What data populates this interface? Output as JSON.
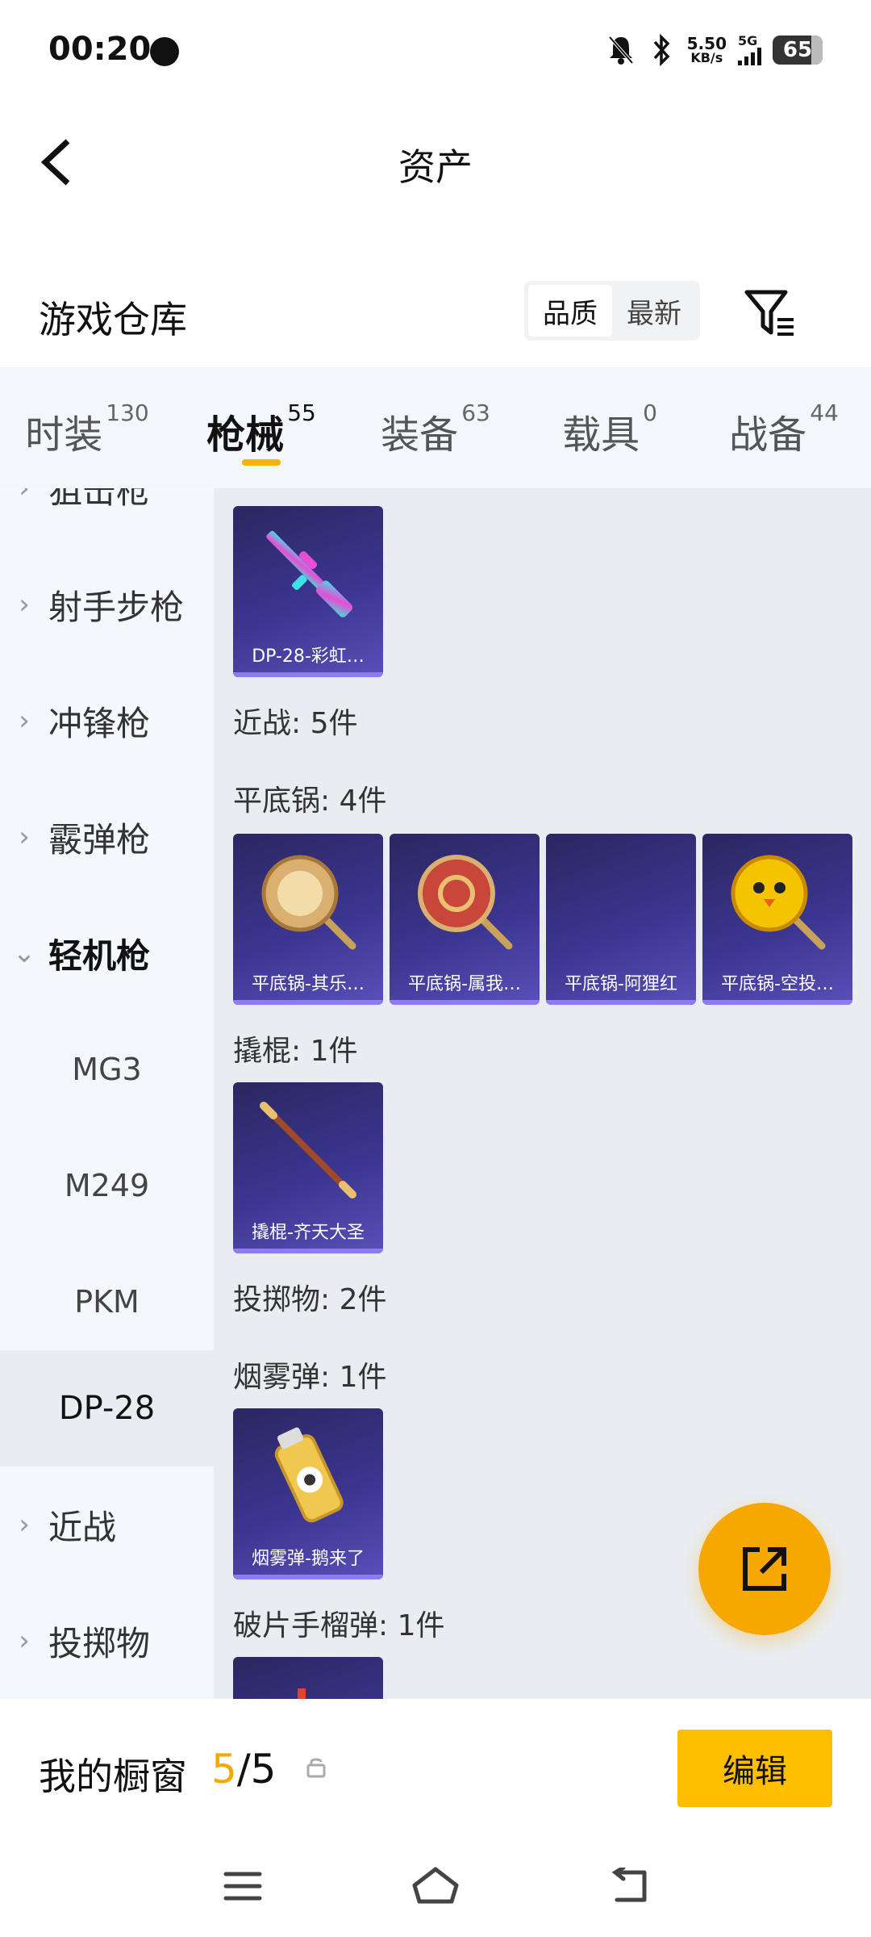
{
  "status_bar": {
    "time": "00:20",
    "speed_value": "5.50",
    "speed_unit": "KB/s",
    "network": "5G",
    "battery": "65"
  },
  "header": {
    "title": "资产"
  },
  "warehouse": {
    "title": "游戏仓库",
    "sort_options": [
      "品质",
      "最新"
    ],
    "sort_selected": "品质"
  },
  "tabs": [
    {
      "label": "时装",
      "count": "130"
    },
    {
      "label": "枪械",
      "count": "55",
      "active": true
    },
    {
      "label": "装备",
      "count": "63"
    },
    {
      "label": "载具",
      "count": "0"
    },
    {
      "label": "战备",
      "count": "44"
    }
  ],
  "sidebar": {
    "items": [
      {
        "label": "狙击枪",
        "type": "category"
      },
      {
        "label": "射手步枪",
        "type": "category"
      },
      {
        "label": "冲锋枪",
        "type": "category"
      },
      {
        "label": "霰弹枪",
        "type": "category"
      },
      {
        "label": "轻机枪",
        "type": "category-open"
      },
      {
        "label": "MG3",
        "type": "sub"
      },
      {
        "label": "M249",
        "type": "sub"
      },
      {
        "label": "PKM",
        "type": "sub"
      },
      {
        "label": "DP-28",
        "type": "sub-selected"
      },
      {
        "label": "近战",
        "type": "category"
      },
      {
        "label": "投掷物",
        "type": "category"
      }
    ]
  },
  "content": {
    "dp28_cards": [
      {
        "name": "DP-28-彩虹…",
        "icon": "rainbow-rifle"
      }
    ],
    "sections": [
      {
        "label": "近战: 5件"
      },
      {
        "label": "平底锅: 4件"
      },
      {
        "label": "撬棍: 1件"
      },
      {
        "label": "投掷物: 2件"
      },
      {
        "label": "烟雾弹: 1件"
      },
      {
        "label": "破片手榴弹: 1件"
      }
    ],
    "pan_cards": [
      {
        "name": "平底锅-其乐…",
        "icon": "pan-gold"
      },
      {
        "name": "平底锅-属我…",
        "icon": "pan-red"
      },
      {
        "name": "平底锅-阿狸红",
        "icon": "empty"
      },
      {
        "name": "平底锅-空投…",
        "icon": "pan-chick"
      }
    ],
    "crowbar_cards": [
      {
        "name": "撬棍-齐天大圣",
        "icon": "golden-staff"
      }
    ],
    "smoke_cards": [
      {
        "name": "烟雾弹-鹅来了",
        "icon": "smoke-goose"
      }
    ]
  },
  "bottom_bar": {
    "title": "我的橱窗",
    "count_current": "5",
    "count_total": "/5",
    "edit_label": "编辑"
  },
  "colors": {
    "accent": "#f6a800",
    "edit_button": "#ffbf00",
    "card_bg": "#3b3590",
    "sidebar_bg": "#f4f7fb",
    "content_bg": "#e9edf2"
  }
}
